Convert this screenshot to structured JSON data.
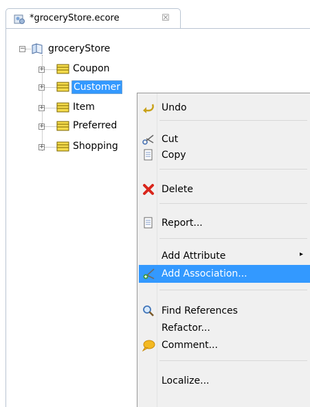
{
  "editor": {
    "tab_title": "*groceryStore.ecore",
    "tab_close": "☒",
    "tab_icon": "ecore-file-icon"
  },
  "tree": {
    "root": {
      "label": "groceryStore",
      "expander": "−",
      "icon": "package-icon"
    },
    "classes": [
      {
        "label": "Coupon",
        "expander": "+"
      },
      {
        "label": "Customer",
        "expander": "+",
        "selected": true
      },
      {
        "label": "Item",
        "expander": "+"
      },
      {
        "label": "Preferred",
        "expander": "+"
      },
      {
        "label": "Shopping",
        "expander": "+"
      }
    ]
  },
  "context_menu": {
    "items": [
      {
        "label": "Undo",
        "icon": "undo-icon"
      },
      {
        "label": "Cut",
        "icon": "scissors-icon"
      },
      {
        "label": "Copy",
        "icon": "copy-icon"
      },
      {
        "label": "Delete",
        "icon": "delete-icon",
        "icon_color": "#d9261c"
      },
      {
        "label": "Report...",
        "icon": "report-icon"
      },
      {
        "label": "Add Attribute",
        "submenu_arrow": "▸"
      },
      {
        "label": "Add Association...",
        "icon": "association-icon",
        "highlighted": true
      },
      {
        "label": "Find References",
        "icon": "magnifier-icon"
      },
      {
        "label": "Refactor..."
      },
      {
        "label": "Comment...",
        "icon": "comment-icon"
      },
      {
        "label": "Localize..."
      }
    ]
  },
  "colors": {
    "selection": "#3399ff",
    "menu_bg": "#f0f0f0",
    "class_icon_fill": "#f5dc4c"
  }
}
